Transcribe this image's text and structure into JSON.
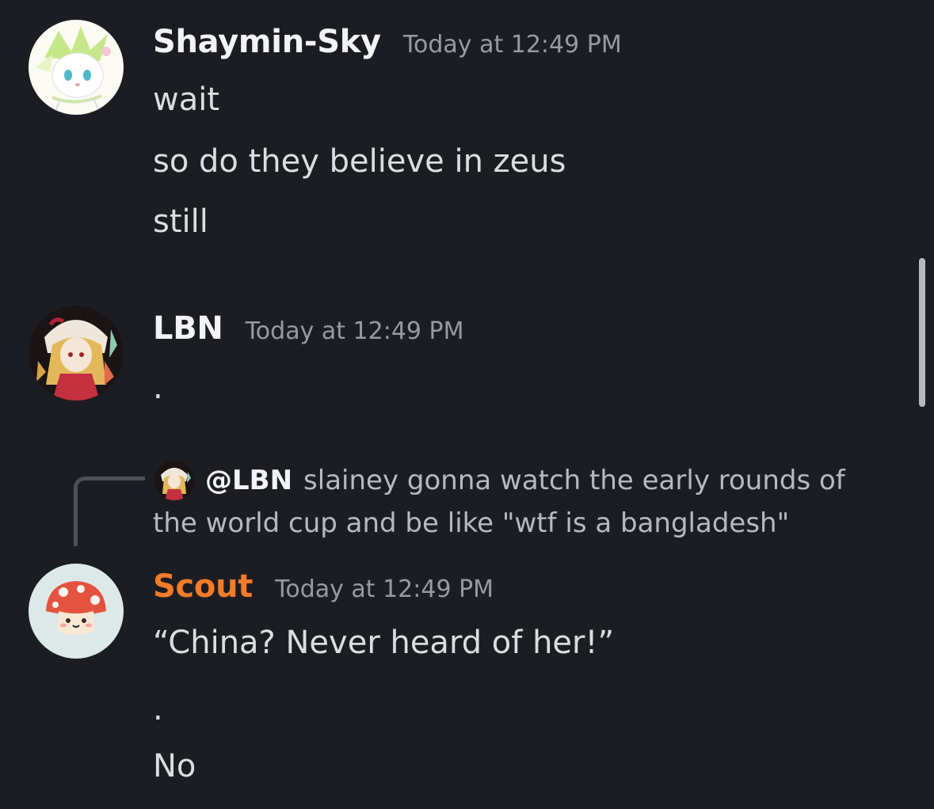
{
  "messages": [
    {
      "username": "Shaymin-Sky",
      "timestamp": "Today at 12:49 PM",
      "avatar_icon": "shaymin-sky-avatar-icon",
      "lines": [
        "wait",
        "so do they believe in zeus",
        "still"
      ]
    },
    {
      "username": "LBN",
      "timestamp": "Today at 12:49 PM",
      "avatar_icon": "anime-character-avatar-icon",
      "lines": [
        "."
      ]
    },
    {
      "username": "Scout",
      "username_color": "#f47b28",
      "timestamp": "Today at 12:49 PM",
      "avatar_icon": "mushroom-avatar-icon",
      "reply": {
        "mention": "@LBN",
        "text": "slainey gonna watch the early rounds of the world cup and be like \"wtf is a bangladesh\""
      },
      "lines": [
        "“China? Never heard of her!”",
        ".",
        "No"
      ]
    }
  ],
  "colors": {
    "background": "#1c1d22",
    "username": "#f2f3f5",
    "timestamp": "#949ba4",
    "message_text": "#dbdee1",
    "reply_text": "#b5bac1",
    "reply_line": "#4e5058"
  }
}
